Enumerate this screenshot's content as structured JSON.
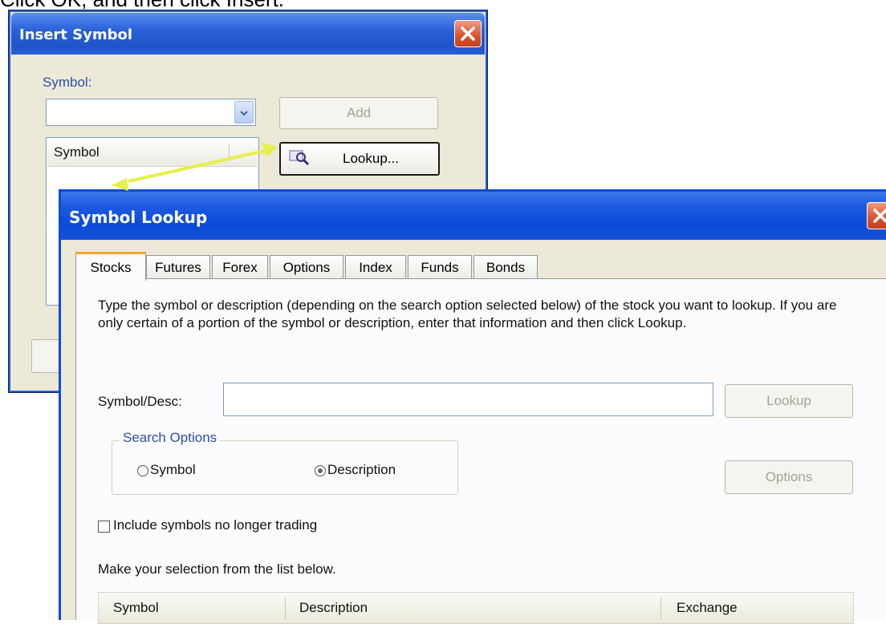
{
  "caption": "Click OK, and then click Insert.",
  "insert_symbol": {
    "title": "Insert Symbol",
    "symbol_label": "Symbol:",
    "symbol_value": "",
    "add_label": "Add",
    "lookup_label": "Lookup...",
    "list_header": "Symbol",
    "close_icon": "close-icon"
  },
  "symbol_lookup": {
    "title": "Symbol Lookup",
    "tabs": [
      "Stocks",
      "Futures",
      "Forex",
      "Options",
      "Index",
      "Funds",
      "Bonds"
    ],
    "active_tab": "Stocks",
    "instructions": "Type the symbol or description (depending on the search option selected below) of the stock you want to lookup.  If you are only certain of a portion of the symbol or description, enter that information and then click Lookup.",
    "symbol_desc_label": "Symbol/Desc:",
    "symbol_desc_value": "",
    "lookup_label": "Lookup",
    "search_options_label": "Search Options",
    "option_symbol": "Symbol",
    "option_description": "Description",
    "selected_option": "Description",
    "options_label": "Options",
    "include_label": "Include symbols no longer trading",
    "include_checked": false,
    "selection_prompt": "Make your selection from the list below.",
    "columns": [
      "Symbol",
      "Description",
      "Exchange"
    ]
  },
  "colors": {
    "titlebar": "#0a4ad8",
    "arrow": "#e6f04a",
    "tab_highlight": "#f5a626"
  }
}
